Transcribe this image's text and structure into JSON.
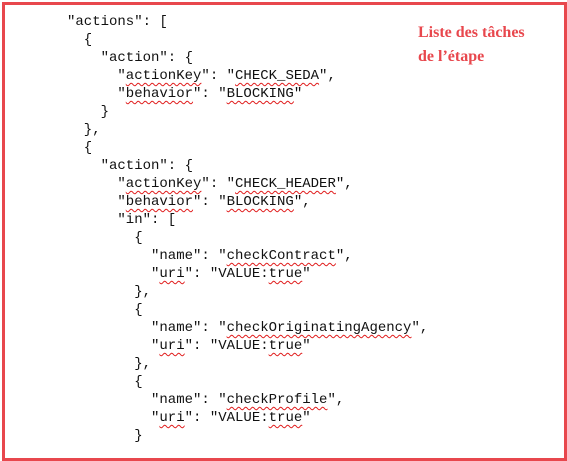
{
  "caption": {
    "line1": "Liste des tâches",
    "line2": "de l’étape"
  },
  "code_lines": [
    {
      "indent": "",
      "segments": [
        {
          "t": "\"actions\": ["
        }
      ]
    },
    {
      "indent": "  ",
      "segments": [
        {
          "t": "{"
        }
      ]
    },
    {
      "indent": "    ",
      "segments": [
        {
          "t": "\"action\": {"
        }
      ]
    },
    {
      "indent": "      ",
      "segments": [
        {
          "t": "\""
        },
        {
          "t": "actionKey",
          "sq": true
        },
        {
          "t": "\": \""
        },
        {
          "t": "CHECK_SEDA",
          "sq": true
        },
        {
          "t": "\","
        }
      ]
    },
    {
      "indent": "      ",
      "segments": [
        {
          "t": "\""
        },
        {
          "t": "behavior",
          "sq": true
        },
        {
          "t": "\": \""
        },
        {
          "t": "BLOCKING",
          "sq": true
        },
        {
          "t": "\""
        }
      ]
    },
    {
      "indent": "    ",
      "segments": [
        {
          "t": "}"
        }
      ]
    },
    {
      "indent": "  ",
      "segments": [
        {
          "t": "},"
        }
      ]
    },
    {
      "indent": "  ",
      "segments": [
        {
          "t": "{"
        }
      ]
    },
    {
      "indent": "    ",
      "segments": [
        {
          "t": "\"action\": {"
        }
      ]
    },
    {
      "indent": "      ",
      "segments": [
        {
          "t": "\""
        },
        {
          "t": "actionKey",
          "sq": true
        },
        {
          "t": "\": \""
        },
        {
          "t": "CHECK_HEADER",
          "sq": true
        },
        {
          "t": "\","
        }
      ]
    },
    {
      "indent": "      ",
      "segments": [
        {
          "t": "\""
        },
        {
          "t": "behavior",
          "sq": true
        },
        {
          "t": "\": \""
        },
        {
          "t": "BLOCKING",
          "sq": true
        },
        {
          "t": "\","
        }
      ]
    },
    {
      "indent": "      ",
      "segments": [
        {
          "t": "\"in\": ["
        }
      ]
    },
    {
      "indent": "        ",
      "segments": [
        {
          "t": "{"
        }
      ]
    },
    {
      "indent": "          ",
      "segments": [
        {
          "t": "\"name\": \""
        },
        {
          "t": "checkContract",
          "sq": true
        },
        {
          "t": "\","
        }
      ]
    },
    {
      "indent": "          ",
      "segments": [
        {
          "t": "\""
        },
        {
          "t": "uri",
          "sq": true
        },
        {
          "t": "\": \"VALUE:"
        },
        {
          "t": "true",
          "sq": true
        },
        {
          "t": "\""
        }
      ]
    },
    {
      "indent": "        ",
      "segments": [
        {
          "t": "},"
        }
      ]
    },
    {
      "indent": "        ",
      "segments": [
        {
          "t": "{"
        }
      ]
    },
    {
      "indent": "          ",
      "segments": [
        {
          "t": "\"name\": \""
        },
        {
          "t": "checkOriginatingAgency",
          "sq": true
        },
        {
          "t": "\","
        }
      ]
    },
    {
      "indent": "          ",
      "segments": [
        {
          "t": "\""
        },
        {
          "t": "uri",
          "sq": true
        },
        {
          "t": "\": \"VALUE:"
        },
        {
          "t": "true",
          "sq": true
        },
        {
          "t": "\""
        }
      ]
    },
    {
      "indent": "        ",
      "segments": [
        {
          "t": "},"
        }
      ]
    },
    {
      "indent": "        ",
      "segments": [
        {
          "t": "{"
        }
      ]
    },
    {
      "indent": "          ",
      "segments": [
        {
          "t": "\"name\": \""
        },
        {
          "t": "checkProfile",
          "sq": true
        },
        {
          "t": "\","
        }
      ]
    },
    {
      "indent": "          ",
      "segments": [
        {
          "t": "\""
        },
        {
          "t": "uri",
          "sq": true
        },
        {
          "t": "\": \"VALUE:"
        },
        {
          "t": "true",
          "sq": true
        },
        {
          "t": "\""
        }
      ]
    },
    {
      "indent": "        ",
      "segments": [
        {
          "t": "}"
        }
      ]
    }
  ]
}
